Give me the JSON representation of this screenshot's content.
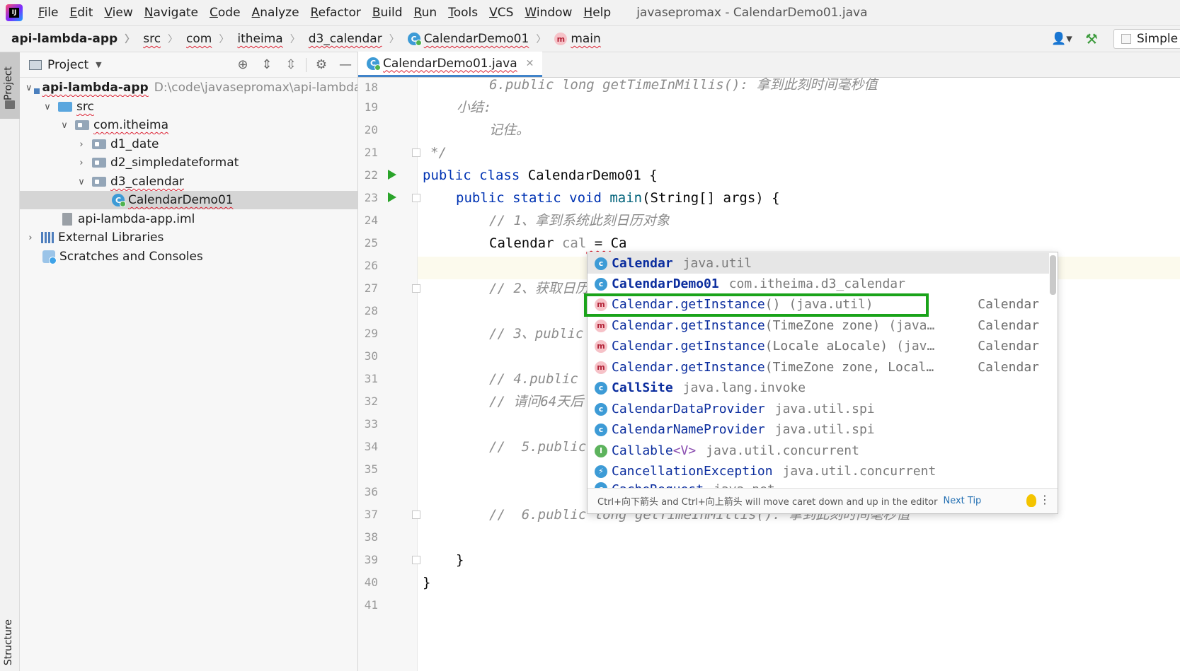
{
  "window": {
    "title": "javasepromax - CalendarDemo01.java",
    "menu": [
      "File",
      "Edit",
      "View",
      "Navigate",
      "Code",
      "Analyze",
      "Refactor",
      "Build",
      "Run",
      "Tools",
      "VCS",
      "Window",
      "Help"
    ]
  },
  "breadcrumb": [
    "api-lambda-app",
    "src",
    "com",
    "itheima",
    "d3_calendar",
    "CalendarDemo01",
    "main"
  ],
  "toolbar": {
    "run_config": "Simple"
  },
  "left_stripe": {
    "project": "Project",
    "structure": "Structure"
  },
  "project_panel": {
    "title": "Project",
    "tree": [
      {
        "label": "api-lambda-app",
        "path": "D:\\code\\javasepromax\\api-lambda-a",
        "icon": "module-folder-icon",
        "expanded": true
      },
      {
        "label": "src",
        "icon": "source-folder-icon",
        "expanded": true
      },
      {
        "label": "com.itheima",
        "icon": "package-icon",
        "expanded": true
      },
      {
        "label": "d1_date",
        "icon": "package-icon",
        "expanded": false
      },
      {
        "label": "d2_simpledateformat",
        "icon": "package-icon",
        "expanded": false
      },
      {
        "label": "d3_calendar",
        "icon": "package-icon",
        "expanded": true
      },
      {
        "label": "CalendarDemo01",
        "icon": "java-class-icon",
        "selected": true
      },
      {
        "label": "api-lambda-app.iml",
        "icon": "iml-file-icon"
      },
      {
        "label": "External Libraries",
        "icon": "libraries-icon",
        "expanded": false
      },
      {
        "label": "Scratches and Consoles",
        "icon": "scratches-icon"
      }
    ]
  },
  "editor": {
    "tab": "CalendarDemo01.java",
    "line_numbers": [
      "18",
      "19",
      "20",
      "21",
      "22",
      "23",
      "24",
      "25",
      "26",
      "27",
      "28",
      "29",
      "30",
      "31",
      "32",
      "33",
      "34",
      "35",
      "36",
      "37",
      "38",
      "39",
      "40",
      "41"
    ],
    "lines": {
      "l18": "6.public long getTimeInMillis(): 拿到此刻时间毫秒值",
      "l19": "小结:",
      "l20": "记住。",
      "l21": "*/",
      "l22_kw": "public class ",
      "l22_rest": "CalendarDemo01 {",
      "l23_kw": "public static void ",
      "l23_m": "main",
      "l23_rest": "(String[] args) {",
      "l24": "// 1、拿到系统此刻日历对象",
      "l25_type": "Calendar ",
      "l25_var": "cal",
      "l25_eq": " = ",
      "l25_typed": "Ca",
      "l27": "// 2、获取日历",
      "l29": "// 3、public",
      "l31": "// 4.public",
      "l32": "// 请问64天后",
      "l34": "//  5.public",
      "l37_a": "//  6.public",
      "l37_b": "long getTimeInMillis(): 拿到此刻时间毫秒值",
      "l39": "}",
      "l40": "}"
    }
  },
  "completion": {
    "items": [
      {
        "icon": "c",
        "name": "Calendar",
        "params": "",
        "location": "java.util",
        "type": ""
      },
      {
        "icon": "c",
        "name": "CalendarDemo01",
        "params": "",
        "location": "com.itheima.d3_calendar",
        "type": ""
      },
      {
        "icon": "m",
        "name": "Calendar.getInstance",
        "params": "()",
        "location": "(java.util)",
        "type": "Calendar"
      },
      {
        "icon": "m",
        "name": "Calendar.getInstance",
        "params": "(TimeZone zone)",
        "location": "(java…",
        "type": "Calendar"
      },
      {
        "icon": "m",
        "name": "Calendar.getInstance",
        "params": "(Locale aLocale)",
        "location": "(jav…",
        "type": "Calendar"
      },
      {
        "icon": "m",
        "name": "Calendar.getInstance",
        "params": "(TimeZone zone, Local…",
        "location": "",
        "type": "Calendar"
      },
      {
        "icon": "c",
        "name": "CallSite",
        "params": "",
        "location": "java.lang.invoke",
        "type": ""
      },
      {
        "icon": "c",
        "name": "CalendarDataProvider",
        "params": "",
        "location": "java.util.spi",
        "type": ""
      },
      {
        "icon": "c",
        "name": "CalendarNameProvider",
        "params": "",
        "location": "java.util.spi",
        "type": ""
      },
      {
        "icon": "i",
        "name": "Callable",
        "params": "<V>",
        "location": "java.util.concurrent",
        "type": ""
      },
      {
        "icon": "e",
        "name": "CancellationException",
        "params": "",
        "location": "java.util.concurrent",
        "type": ""
      },
      {
        "icon": "c",
        "name": "CacheRequest",
        "params": "",
        "location": "java.net",
        "type": ""
      }
    ],
    "footer_hint": "Ctrl+向下箭头 and Ctrl+向上箭头 will move caret down and up in the editor",
    "footer_link": "Next Tip"
  }
}
